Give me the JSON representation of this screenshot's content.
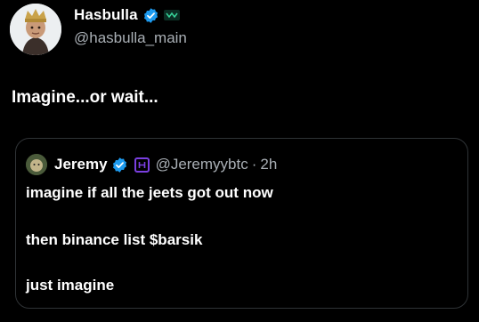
{
  "post": {
    "author_name": "Hasbulla",
    "author_handle": "@hasbulla_main",
    "text": "Imagine...or wait..."
  },
  "quoted": {
    "author_name": "Jeremy",
    "author_handle": "@Jeremyybtc",
    "separator": "·",
    "time": "2h",
    "lines": [
      "imagine if all the jeets got out now",
      "then binance list $barsik",
      "just imagine"
    ]
  },
  "colors": {
    "background": "#000000",
    "verified_blue": "#1d9bf0",
    "muted_text": "#a9afb5",
    "border": "#2f3336",
    "affiliate_badge": "#7a3fe0"
  }
}
